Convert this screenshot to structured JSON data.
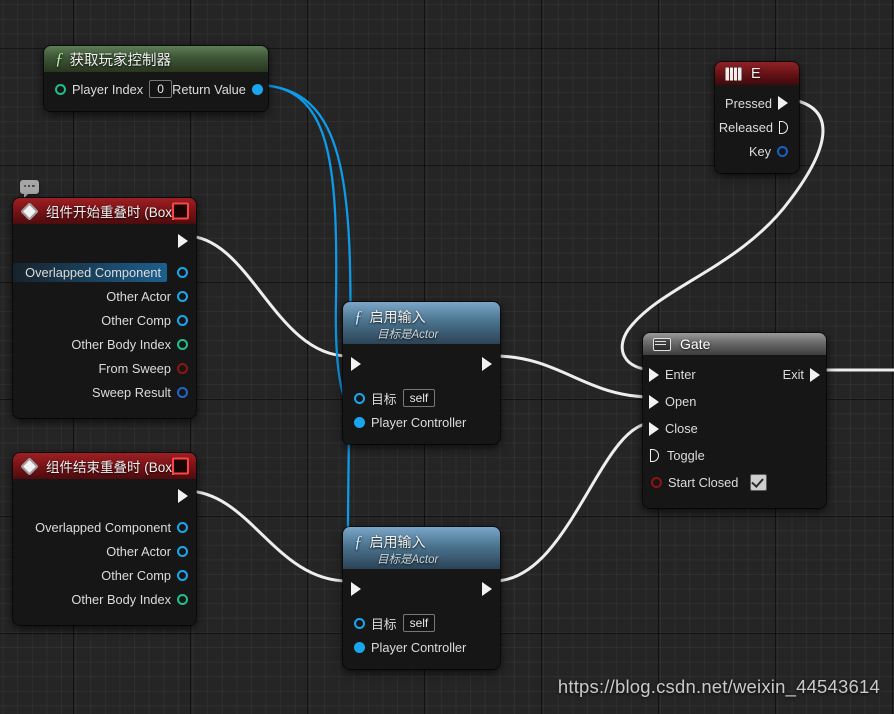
{
  "app": {
    "editor": "Unreal Engine Blueprint Event Graph",
    "watermark": "https://blog.csdn.net/weixin_44543614"
  },
  "colors": {
    "exec_white": "#f2f2f2",
    "object_blue": "#1aa6ef",
    "int_green": "#1fc08a",
    "bool_red": "#8e1414",
    "struct_blue": "#1e67c9",
    "event_red": "#7c1418",
    "function_green": "#3e5738",
    "function_blue": "#4b748f",
    "gate_gray": "#6e6e6e",
    "wire_exec": "#ffffff",
    "wire_data": "#0e9ae8",
    "canvas_bg": "#252525"
  },
  "nodes": {
    "get_player_controller": {
      "title": "获取玩家控制器",
      "icon": "function-f-icon",
      "inputs": [
        {
          "label": "Player Index",
          "pin": "int-pin",
          "value": "0"
        }
      ],
      "outputs": [
        {
          "label": "Return Value",
          "pin": "object-pin"
        }
      ]
    },
    "input_key_e": {
      "title": "E",
      "icon": "keyboard-icon",
      "outputs": [
        {
          "label": "Pressed",
          "pin": "exec-pin"
        },
        {
          "label": "Released",
          "pin": "exec-pin-hollow"
        },
        {
          "label": "Key",
          "pin": "key-struct-pin"
        }
      ]
    },
    "begin_overlap": {
      "title": "组件开始重叠时 (Box)",
      "icon": "event-diamond-icon",
      "badge": "stop-button-icon",
      "comment_icon": "comment-bubble-icon",
      "outputs": [
        {
          "label": "Overlapped Component",
          "pin": "object-pin",
          "highlighted": true
        },
        {
          "label": "Other Actor",
          "pin": "object-pin",
          "highlighted": false
        },
        {
          "label": "Other Comp",
          "pin": "object-pin",
          "highlighted": false
        },
        {
          "label": "Other Body Index",
          "pin": "int-pin",
          "highlighted": false
        },
        {
          "label": "From Sweep",
          "pin": "bool-pin",
          "highlighted": false
        },
        {
          "label": "Sweep Result",
          "pin": "struct-pin",
          "highlighted": false
        }
      ]
    },
    "end_overlap": {
      "title": "组件结束重叠时 (Box)",
      "icon": "event-diamond-icon",
      "badge": "stop-button-icon",
      "outputs": [
        {
          "label": "Overlapped Component",
          "pin": "object-pin"
        },
        {
          "label": "Other Actor",
          "pin": "object-pin"
        },
        {
          "label": "Other Comp",
          "pin": "object-pin"
        },
        {
          "label": "Other Body Index",
          "pin": "int-pin"
        }
      ]
    },
    "enable_input_1": {
      "title": "启用输入",
      "subtitle": "目标是Actor",
      "icon": "function-f-icon",
      "inputs": [
        {
          "label": "目标",
          "pin": "object-pin",
          "value": "self"
        },
        {
          "label": "Player Controller",
          "pin": "object-pin-connected"
        }
      ]
    },
    "enable_input_2": {
      "title": "启用输入",
      "subtitle": "目标是Actor",
      "icon": "function-f-icon",
      "inputs": [
        {
          "label": "目标",
          "pin": "object-pin",
          "value": "self"
        },
        {
          "label": "Player Controller",
          "pin": "object-pin-connected"
        }
      ]
    },
    "gate": {
      "title": "Gate",
      "icon": "gate-icon",
      "inputs": [
        {
          "label": "Enter",
          "pin": "exec-pin"
        },
        {
          "label": "Open",
          "pin": "exec-pin"
        },
        {
          "label": "Close",
          "pin": "exec-pin"
        },
        {
          "label": "Toggle",
          "pin": "exec-pin-hollow"
        },
        {
          "label": "Start Closed",
          "pin": "bool-pin",
          "checked": true
        }
      ],
      "outputs": [
        {
          "label": "Exit",
          "pin": "exec-pin"
        }
      ]
    }
  }
}
